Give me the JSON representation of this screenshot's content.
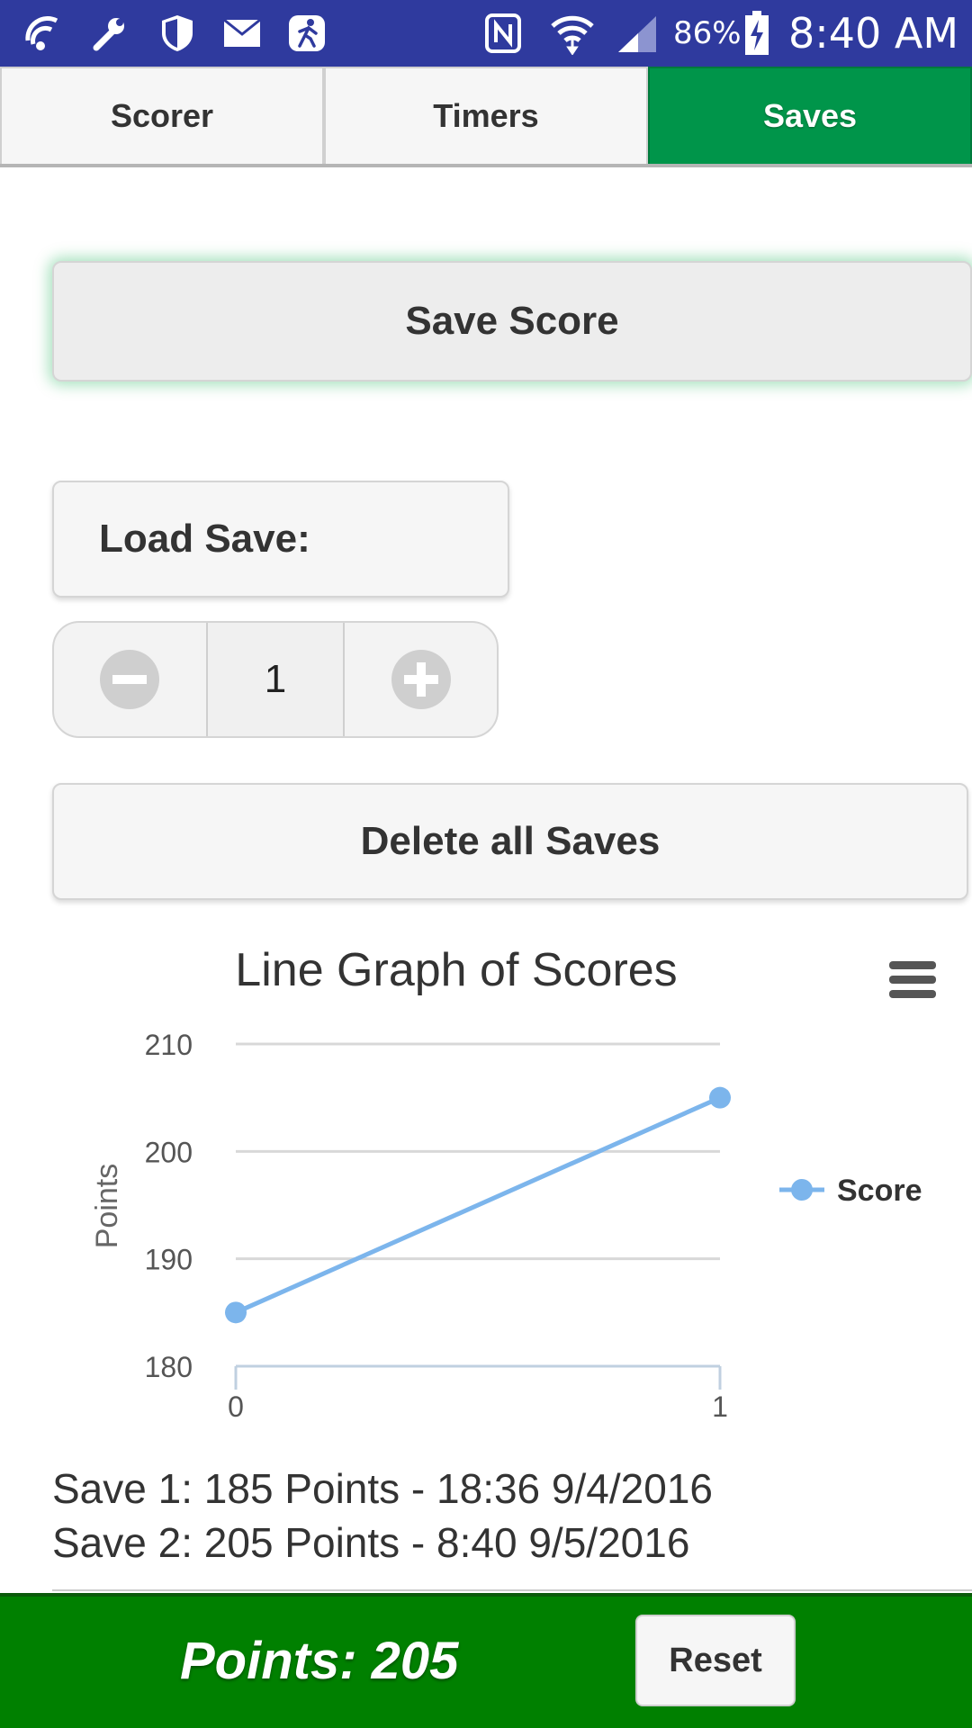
{
  "status_bar": {
    "battery_percent": "86%",
    "time": "8:40 AM",
    "icons": [
      "wifi-call-icon",
      "wrench-icon",
      "shield-icon",
      "mail-icon",
      "running-icon",
      "nfc-icon",
      "wifi-icon",
      "signal-icon",
      "battery-charging-icon"
    ]
  },
  "tabs": [
    {
      "label": "Scorer",
      "active": false
    },
    {
      "label": "Timers",
      "active": false
    },
    {
      "label": "Saves",
      "active": true
    }
  ],
  "colors": {
    "accent_green": "#00954a",
    "footer_green": "#008000",
    "status_bar": "#2f3a9e",
    "series": "#7cb5ec"
  },
  "buttons": {
    "save_score": "Save Score",
    "load_save": "Load Save:",
    "delete_all": "Delete all Saves",
    "reset": "Reset"
  },
  "stepper": {
    "value": "1",
    "minus_icon": "minus-circle-icon",
    "plus_icon": "plus-circle-icon"
  },
  "chart_data": {
    "type": "line",
    "title": "Line Graph of Scores",
    "ylabel": "Points",
    "xlabel": "",
    "x": [
      0,
      1
    ],
    "x_ticks": [
      "0",
      "1"
    ],
    "y_ticks": [
      "180",
      "190",
      "200",
      "210"
    ],
    "ylim": [
      180,
      210
    ],
    "xlim": [
      0,
      1
    ],
    "grid": true,
    "legend": "right",
    "series": [
      {
        "name": "Score",
        "values": [
          185,
          205
        ],
        "color": "#7cb5ec"
      }
    ]
  },
  "saves": [
    "Save 1: 185 Points - 18:36 9/4/2016",
    "Save 2: 205 Points - 8:40 9/5/2016"
  ],
  "footer": {
    "points_label": "Points: 205"
  }
}
